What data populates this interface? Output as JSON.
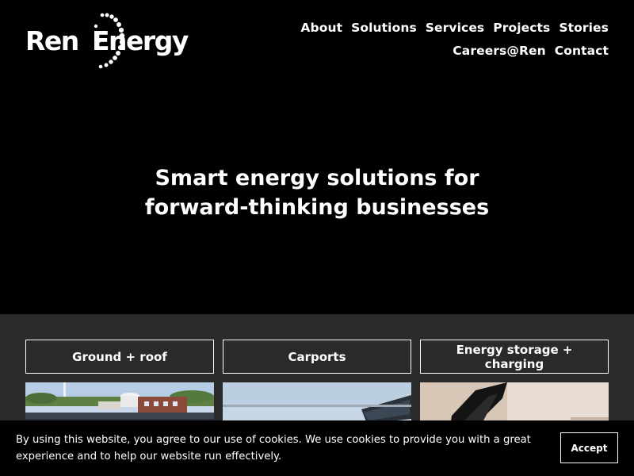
{
  "brand": {
    "name_part1": "Ren",
    "name_part2": "Energy",
    "logo_icon": "sun-dots-icon"
  },
  "nav": {
    "items": [
      "About",
      "Solutions",
      "Services",
      "Projects",
      "Stories",
      "Careers@Ren",
      "Contact"
    ]
  },
  "hero": {
    "title": "Smart energy solutions for forward-thinking businesses"
  },
  "solutions": {
    "tiles": [
      {
        "label": "Ground + roof"
      },
      {
        "label": "Carports"
      },
      {
        "label": "Energy storage + charging"
      }
    ]
  },
  "cookie": {
    "text": "By using this website, you agree to our use of cookies. We use cookies to provide you with a great experience and to help our website run effectively.",
    "accept_label": "Accept"
  },
  "colors": {
    "background": "#000000",
    "panel": "#2a2a2a",
    "text": "#ffffff"
  }
}
